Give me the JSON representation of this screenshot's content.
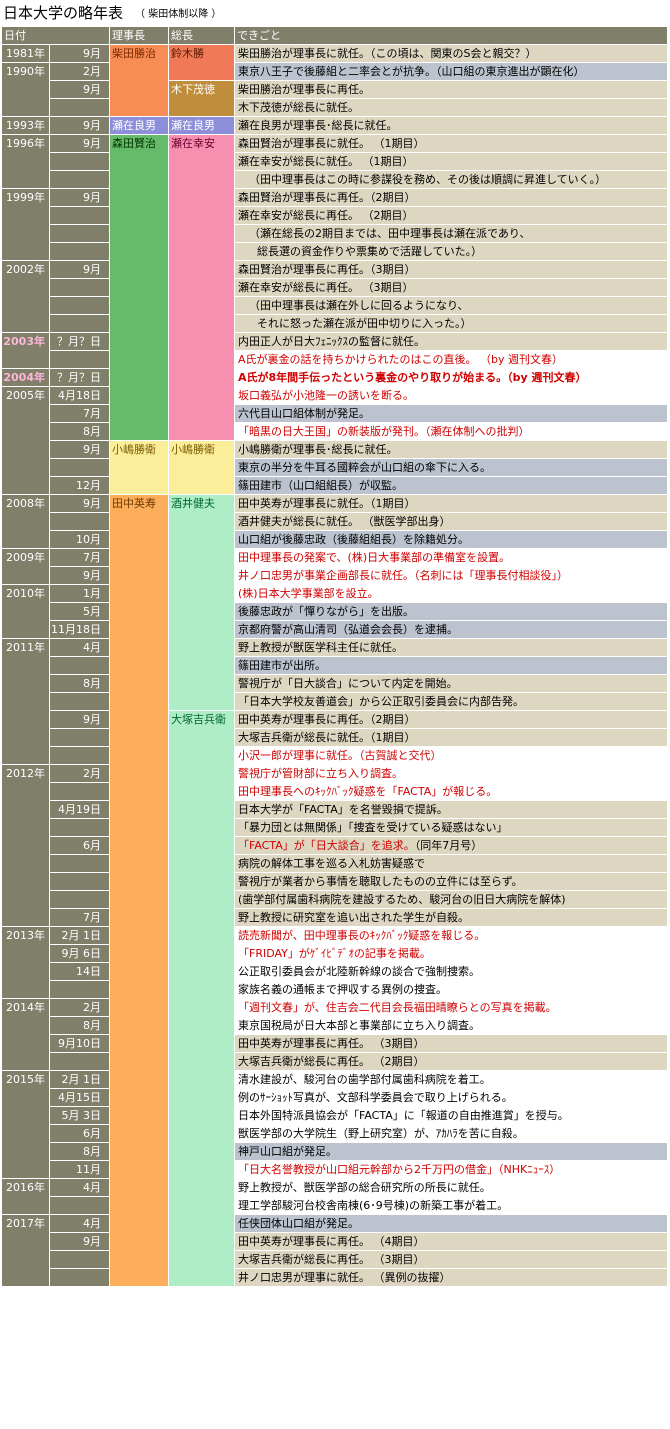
{
  "title": "日本大学の略年表",
  "subtitle": "（ 柴田体制以降 ）",
  "headers": {
    "date": "日付",
    "chairman": "理事長",
    "president": "総長",
    "events": "できごと"
  },
  "colors": {
    "header": "#7f7f6a",
    "event_default": "#ddd7c1",
    "event_blue": "#bcc3cf",
    "red_text": "#d00000"
  },
  "rows": [
    {
      "year": "1981年",
      "date": "9月",
      "text": "柴田勝治が理事長に就任。（この頃は、関東のS会と親交？）"
    },
    {
      "year": "1990年",
      "date": "2月",
      "text": "東京八王子で後藤組と二率会とが抗争。（山口組の東京進出が顕在化）",
      "bg": "blue"
    },
    {
      "year": "",
      "date": "9月",
      "text": "柴田勝治が理事長に再任。"
    },
    {
      "year": "",
      "date": "",
      "text": "木下茂徳が総長に就任。"
    },
    {
      "year": "1993年",
      "date": "9月",
      "text": "瀬在良男が理事長･総長に就任。"
    },
    {
      "year": "1996年",
      "date": "9月",
      "text": "森田賢治が理事長に就任。 （1期目）"
    },
    {
      "year": "",
      "date": "",
      "text": "瀬在幸安が総長に就任。 （1期目）"
    },
    {
      "year": "",
      "date": "",
      "text": "（田中理事長はこの時に参謀役を務め、その後は順調に昇進していく。）",
      "indent": 1
    },
    {
      "year": "1999年",
      "date": "9月",
      "text": "森田賢治が理事長に再任。（2期目）"
    },
    {
      "year": "",
      "date": "",
      "text": "瀬在幸安が総長に再任。 （2期目）"
    },
    {
      "year": "",
      "date": "",
      "text": "（瀬在総長の2期目までは、田中理事長は瀬在派であり、",
      "indent": 1
    },
    {
      "year": "",
      "date": "",
      "text": "総長選の資金作りや票集めで活躍していた。）",
      "indent": 2
    },
    {
      "year": "2002年",
      "date": "9月",
      "text": "森田賢治が理事長に再任。（3期目）"
    },
    {
      "year": "",
      "date": "",
      "text": "瀬在幸安が総長に再任。 （3期目）"
    },
    {
      "year": "",
      "date": "",
      "text": "（田中理事長は瀬在外しに回るようになり、",
      "indent": 1
    },
    {
      "year": "",
      "date": "",
      "text": "それに怒った瀬在派が田中切りに入った。）",
      "indent": 2
    },
    {
      "year": "2003年",
      "year_style": "pink",
      "date": "？月？日",
      "text": "内田正人が日大ﾌｪﾆｯｸｽの監督に就任。"
    },
    {
      "year": "",
      "date": "",
      "text": "A氏が裏金の話を持ちかけられたのはこの直後。 （by 週刊文春）",
      "style": "red",
      "bg": "white"
    },
    {
      "year": "2004年",
      "year_style": "pink",
      "date": "？月？日",
      "text": "A氏が8年間手伝ったという裏金のやり取りが始まる。（by 週刊文春）",
      "style": "red-bold",
      "bg": "white"
    },
    {
      "year": "2005年",
      "date": "4月18日",
      "text": "坂口義弘が小池隆一の誘いを断る。",
      "style": "red",
      "bg": "white"
    },
    {
      "year": "",
      "date": "7月",
      "text": "六代目山口組体制が発足。",
      "bg": "blue"
    },
    {
      "year": "",
      "date": "8月",
      "text": "「暗黒の日大王国」の新装版が発刊。（瀬在体制への批判）",
      "style": "red",
      "bg": "white"
    },
    {
      "year": "",
      "date": "9月",
      "text": "小嶋勝衛が理事長･総長に就任。"
    },
    {
      "year": "",
      "date": "",
      "text": "東京の半分を牛耳る國粹会が山口組の傘下に入る。",
      "bg": "blue"
    },
    {
      "year": "",
      "date": "12月",
      "text": "篠田建市（山口組組長）が収監。",
      "bg": "blue"
    },
    {
      "year": "2008年",
      "date": "9月",
      "text": "田中英寿が理事長に就任。（1期目）"
    },
    {
      "year": "",
      "date": "",
      "text": "酒井健夫が総長に就任。 （獣医学部出身）"
    },
    {
      "year": "",
      "date": "10月",
      "text": "山口組が後藤忠政（後藤組組長）を除籍処分。",
      "bg": "blue"
    },
    {
      "year": "2009年",
      "date": "7月",
      "text": "田中理事長の発案で、(株)日大事業部の準備室を設置。",
      "style": "red",
      "bg": "white"
    },
    {
      "year": "",
      "date": "9月",
      "text": "井ノ口忠男が事業企画部長に就任。（名刺には「理事長付相談役」）",
      "style": "red",
      "bg": "white"
    },
    {
      "year": "2010年",
      "date": "1月",
      "text": "(株)日本大学事業部を設立。",
      "style": "red",
      "bg": "white"
    },
    {
      "year": "",
      "date": "5月",
      "text": "後藤忠政が「憚りながら」を出版。",
      "bg": "blue"
    },
    {
      "year": "",
      "date": "11月18日",
      "text": "京都府警が高山清司（弘道会会長）を逮捕。",
      "bg": "blue"
    },
    {
      "year": "2011年",
      "date": "4月",
      "text": "野上教授が獣医学科主任に就任。"
    },
    {
      "year": "",
      "date": "",
      "text": "篠田建市が出所。",
      "bg": "blue"
    },
    {
      "year": "",
      "date": "8月",
      "text": "警視庁が「日大談合」について内定を開始。"
    },
    {
      "year": "",
      "date": "",
      "text": "「日本大学校友善道会」から公正取引委員会に内部告発。"
    },
    {
      "year": "",
      "date": "9月",
      "text": "田中英寿が理事長に再任。（2期目）"
    },
    {
      "year": "",
      "date": "",
      "text": "大塚吉兵衛が総長に就任。（1期目）"
    },
    {
      "year": "",
      "date": "",
      "text": "小沢一郎が理事に就任。（古賀誠と交代）",
      "style": "red",
      "bg": "white"
    },
    {
      "year": "2012年",
      "date": "2月",
      "text": "警視庁が管財部に立ち入り調査。",
      "style": "red",
      "bg": "white"
    },
    {
      "year": "",
      "date": "",
      "text": "田中理事長へのｷｯｸﾊﾞｯｸ疑惑を「FACTA」が報じる。",
      "style": "red",
      "bg": "white"
    },
    {
      "year": "",
      "date": "4月19日",
      "text": "日本大学が「FACTA」を名誉毀損で提訴。"
    },
    {
      "year": "",
      "date": "",
      "text": "「暴力団とは無関係」「捜査を受けている疑惑はない」"
    },
    {
      "year": "",
      "date": "6月",
      "text": "「FACTA」が「日大談合」を追求。（同年7月号）",
      "style": "red-prefix",
      "prefix": "「FACTA」が「日大談合」を追求。",
      "suffix": "（同年7月号）"
    },
    {
      "year": "",
      "date": "",
      "text": "病院の解体工事を巡る入札妨害疑惑で"
    },
    {
      "year": "",
      "date": "",
      "text": "警視庁が業者から事情を聴取したものの立件には至らず。"
    },
    {
      "year": "",
      "date": "",
      "text": "(歯学部付属歯科病院を建設するため、駿河台の旧日大病院を解体)"
    },
    {
      "year": "",
      "date": "7月",
      "text": "野上教授に研究室を追い出された学生が自殺。"
    },
    {
      "year": "2013年",
      "date": "2月 1日",
      "text": "読売新聞が、田中理事長のｷｯｸﾊﾞｯｸ疑惑を報じる。",
      "style": "red",
      "bg": "white"
    },
    {
      "year": "",
      "date": "9月 6日",
      "text": "「FRIDAY」がｹﾞｲﾋﾞﾃﾞｵの記事を掲載。",
      "style": "red",
      "bg": "white"
    },
    {
      "year": "",
      "date": "14日",
      "text": "公正取引委員会が北陸新幹線の談合で強制捜索。",
      "bg": "white"
    },
    {
      "year": "",
      "date": "",
      "text": "家族名義の通帳まで押収する異例の捜査。",
      "bg": "white"
    },
    {
      "year": "2014年",
      "date": "2月",
      "text": "「週刊文春」が、住吉会二代目会長福田晴瞭らとの写真を掲載。",
      "style": "red",
      "bg": "white"
    },
    {
      "year": "",
      "date": "8月",
      "text": "東京国税局が日大本部と事業部に立ち入り調査。",
      "bg": "white"
    },
    {
      "year": "",
      "date": "9月10日",
      "text": "田中英寿が理事長に再任。 （3期目）"
    },
    {
      "year": "",
      "date": "",
      "text": "大塚吉兵衛が総長に再任。 （2期目）"
    },
    {
      "year": "2015年",
      "date": "2月 1日",
      "text": "清水建設が、駿河台の歯学部付属歯科病院を着工。",
      "bg": "white"
    },
    {
      "year": "",
      "date": "4月15日",
      "text": "例のｻｰｼｮｯﾄ写真が、文部科学委員会で取り上げられる。",
      "bg": "white"
    },
    {
      "year": "",
      "date": "5月 3日",
      "text": "日本外国特派員協会が「FACTA」に「報道の自由推進賞」を授与。",
      "bg": "white"
    },
    {
      "year": "",
      "date": "6月",
      "text": "獣医学部の大学院生（野上研究室）が、ｱｶﾊﾗを苦に自殺。",
      "bg": "white"
    },
    {
      "year": "",
      "date": "8月",
      "text": "神戸山口組が発足。",
      "bg": "blue"
    },
    {
      "year": "",
      "date": "11月",
      "text": "「日大名誉教授が山口組元幹部から2千万円の借金」（NHKﾆｭｰｽ）",
      "style": "red",
      "bg": "white"
    },
    {
      "year": "2016年",
      "date": "4月",
      "text": "野上教授が、獣医学部の総合研究所の所長に就任。",
      "bg": "white"
    },
    {
      "year": "",
      "date": "",
      "text": "理工学部駿河台校舎南棟(6･9号棟)の新築工事が着工。",
      "bg": "white"
    },
    {
      "year": "2017年",
      "date": "4月",
      "text": "任侠団体山口組が発足。",
      "bg": "blue"
    },
    {
      "year": "",
      "date": "9月",
      "text": "田中英寿が理事長に再任。 （4期目）"
    },
    {
      "year": "",
      "date": "",
      "text": "大塚吉兵衛が総長に再任。 （3期目）"
    },
    {
      "year": "",
      "date": "",
      "text": "井ノ口忠男が理事に就任。 （異例の抜擢）"
    }
  ],
  "chairmen": [
    {
      "name": "柴田勝治",
      "start": 0,
      "span": 4,
      "color": "#f88c55",
      "text_color": "#7a2a00"
    },
    {
      "name": "瀬在良男",
      "start": 4,
      "span": 1,
      "color": "#8d8ed9",
      "text_color": "#ffffff"
    },
    {
      "name": "森田賢治",
      "start": 5,
      "span": 17,
      "color": "#66bb6a",
      "text_color": "#003300"
    },
    {
      "name": "小嶋勝衛",
      "start": 22,
      "span": 3,
      "color": "#fbee9a",
      "text_color": "#7a5a00"
    },
    {
      "name": "田中英寿",
      "start": 25,
      "span": 45,
      "color": "#fdae5a",
      "text_color": "#6a3a00"
    }
  ],
  "presidents": [
    {
      "name": "鈴木勝",
      "start": 0,
      "span": 2,
      "color": "#f07a58",
      "text_color": "#5a1a00"
    },
    {
      "name": "木下茂徳",
      "start": 2,
      "span": 2,
      "color": "#bf8d3c",
      "text_color": "#ffffff"
    },
    {
      "name": "瀬在良男",
      "start": 4,
      "span": 1,
      "color": "#8d8ed9",
      "text_color": "#ffffff"
    },
    {
      "name": "瀬在幸安",
      "start": 5,
      "span": 17,
      "color": "#f68fb0",
      "text_color": "#6a0030"
    },
    {
      "name": "小嶋勝衛",
      "start": 22,
      "span": 3,
      "color": "#fbee9a",
      "text_color": "#7a5a00"
    },
    {
      "name": "酒井健夫",
      "start": 25,
      "span": 12,
      "color": "#aeedc6",
      "text_color": "#006633"
    },
    {
      "name": "大塚吉兵衛",
      "start": 37,
      "span": 33,
      "color": "#aeedc6",
      "text_color": "#006633"
    }
  ]
}
